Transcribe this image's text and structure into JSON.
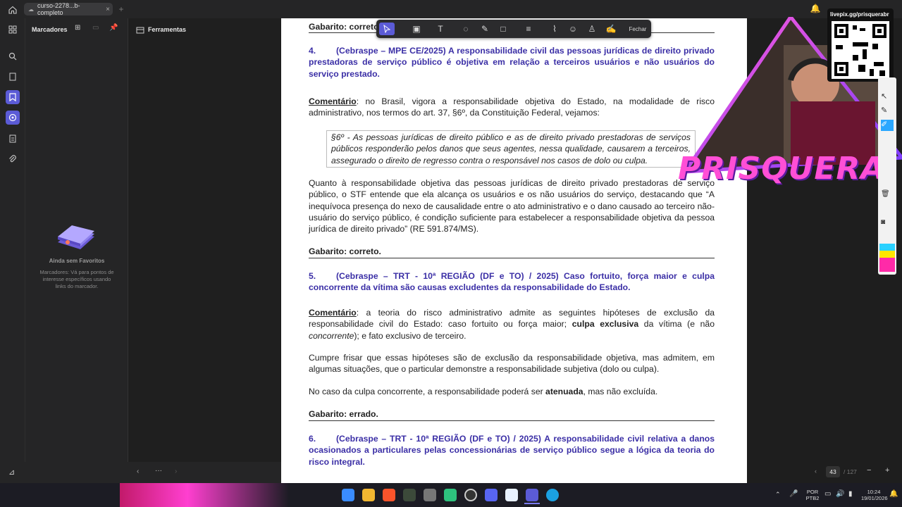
{
  "tab": {
    "title": "curso-2278...b-completo"
  },
  "panel": {
    "title": "Marcadores",
    "tools_title": "Ferramentas",
    "empty_title": "Ainda sem Favoritos",
    "empty_desc": "Marcadores: Vá para pontos de interesse específicos usando links do marcador."
  },
  "toolbar": {
    "close_label": "Fechar"
  },
  "doc": {
    "gab_top": "Gabarito: correto",
    "q4_num": "4.",
    "q4_text": "(Cebraspe – MPE CE/2025) A responsabilidade civil das pessoas jurídicas de direito privado prestadoras de serviço público é objetiva em relação a terceiros usuários e não usuários do serviço prestado.",
    "c4_label": "Comentário",
    "c4_text": ": no Brasil, vigora a responsabilidade objetiva do Estado, na modalidade de risco administrativo, nos termos do art. 37, §6º, da Constituição Federal, vejamos:",
    "quote": "§6º - As pessoas jurídicas de direito público e as de direito privado prestadoras de serviços públicos responderão pelos danos que seus agentes, nessa qualidade, causarem a terceiros, assegurado o direito de regresso contra o responsável nos casos de dolo ou culpa.",
    "p4b": "Quanto à responsabilidade objetiva das pessoas jurídicas de direito privado prestadoras de serviço público, o STF entende que ela alcança os usuários e os não usuários do serviço, destacando que “A inequívoca presença do nexo de causalidade entre o ato administrativo e o dano causado ao terceiro não-usuário do serviço público, é condição suficiente para estabelecer a responsabilidade objetiva da pessoa jurídica de direito privado” (RE 591.874/MS).",
    "gab4": "Gabarito: correto.",
    "q5_num": "5.",
    "q5_text_a": "(Cebraspe – TRT - 10ª REGIÃO (DF e TO) / 2025)",
    "q5_text_b": " Caso fortuito, força maior e culpa concorrente da vítima são causas excludentes da responsabilidade do Estado.",
    "c5_label": "Comentário",
    "c5_text_a": ": a teoria do risco administrativo admite as seguintes hipóteses de exclusão da responsabilidade civil do Estado: caso fortuito ou força maior; ",
    "c5_bold": "culpa exclusiva",
    "c5_text_b": " da vítima (e não ",
    "c5_ital": "concorrente",
    "c5_text_c": "); e fato exclusivo de terceiro.",
    "p5b": "Cumpre frisar que essas hipóteses são de exclusão da responsabilidade objetiva, mas admitem, em algumas situações, que o particular demonstre a responsabilidade subjetiva (dolo ou culpa).",
    "p5c_a": "No caso da culpa concorrente, a responsabilidade poderá ser ",
    "p5c_bold": "atenuada",
    "p5c_b": ", mas não excluída.",
    "gab5": "Gabarito: errado.",
    "q6_num": "6.",
    "q6_text": "(Cebraspe – TRT - 10ª REGIÃO (DF e TO) / 2025) A responsabilidade civil relativa a danos ocasionados a particulares pelas concessionárias de serviço público segue a lógica da teoria do risco integral."
  },
  "overlay": {
    "link": "livepix.gg/prisquerabr",
    "brand": "PRISQUERA"
  },
  "pager": {
    "current": "43",
    "total": "/ 127",
    "dots": "···"
  },
  "tray": {
    "lang1": "POR",
    "lang2": "PTB2",
    "time": "10:24",
    "date": "19/01/2026"
  },
  "colors": {
    "accent": "#5b5bd6",
    "question": "#3b2fa6",
    "brand_pink": "#ff3fd0"
  },
  "icons": [
    "home-icon",
    "search-icon",
    "page-icon",
    "bookmark-icon",
    "ai-icon",
    "list-icon",
    "clip-icon",
    "select-icon",
    "text-icon",
    "comment-icon",
    "pen-icon",
    "shape-icon",
    "stamp-icon",
    "sign-icon"
  ]
}
